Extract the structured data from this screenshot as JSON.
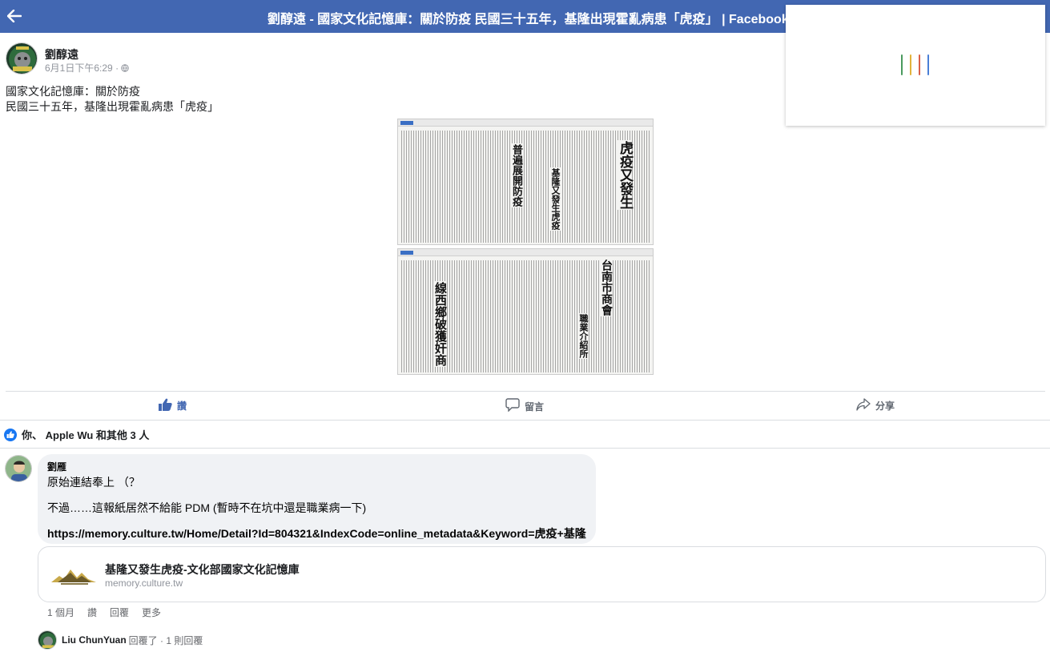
{
  "window": {
    "title": "劉醇遠 - 國家文化記憶庫：關於防疫 民國三十五年，基隆出現霍亂病患「虎疫」 | Facebook",
    "back_icon": "back-arrow-icon"
  },
  "loading_indicator": {
    "colors": [
      "#4a9a5e",
      "#e2b33c",
      "#d9604a",
      "#4a7fd6"
    ]
  },
  "post": {
    "author": "劉醇遠",
    "timestamp": "6月1日下午6:29",
    "separator": "·",
    "privacy_icon": "globe-icon",
    "text_line1": "國家文化記憶庫：關於防疫",
    "text_line2": "民國三十五年，基隆出現霍亂病患「虎疫」",
    "images": [
      {
        "headline": "虎疫又發生",
        "sub1": "基隆又發生虎疫",
        "sub2": "普遍展開防疫"
      },
      {
        "headline": "線西鄉破獲奸商",
        "sub1": "台南市商會",
        "sub2": "職業介紹所"
      }
    ]
  },
  "actions": {
    "like": "讚",
    "comment": "留言",
    "share": "分享"
  },
  "likes_summary": "你、 Apple Wu 和其他 3 人",
  "comment": {
    "author": "劉雁",
    "line1": "原始連結奉上 （？",
    "line2": "不過……這報紙居然不給能 PDM (暫時不在坑中還是職業病一下)",
    "link": "https://memory.culture.tw/Home/Detail?Id=804321&IndexCode=online_metadata&Keyword=虎疫+基隆",
    "preview_title": "基隆又發生虎疫-文化部國家文化記憶庫",
    "preview_domain": "memory.culture.tw",
    "time": "1 個月",
    "like": "讚",
    "reply": "回覆",
    "more": "更多"
  },
  "reply_summary": {
    "name": "Liu ChunYuan",
    "text": "回覆了 · 1 則回覆"
  }
}
